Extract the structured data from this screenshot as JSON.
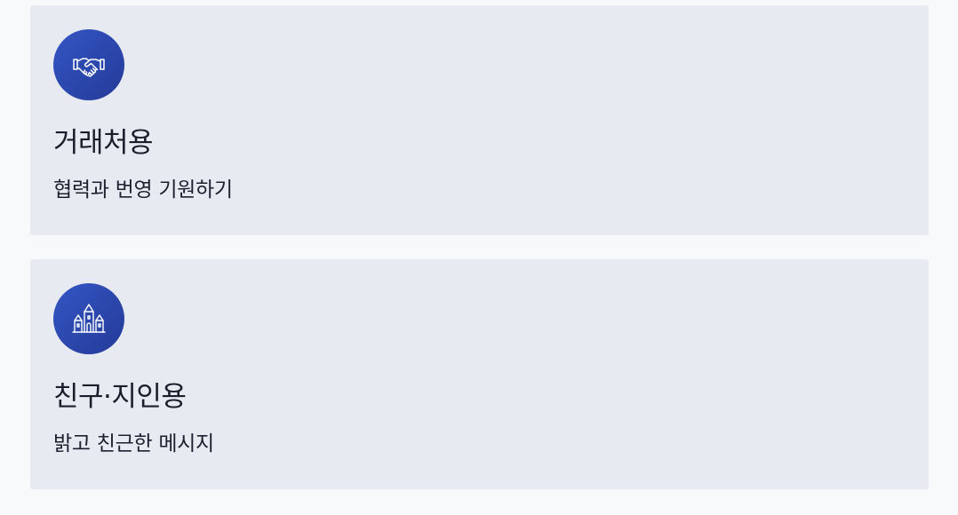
{
  "cards": [
    {
      "icon": "handshake-icon",
      "title": "거래처용",
      "subtitle": "협력과 번영 기원하기"
    },
    {
      "icon": "castle-icon",
      "title": "친구·지인용",
      "subtitle": "밝고 친근한 메시지"
    }
  ],
  "colors": {
    "card_background": "#e8eaf2",
    "icon_gradient_start": "#3456c4",
    "icon_gradient_end": "#243a98",
    "text": "#1b1d2b"
  }
}
